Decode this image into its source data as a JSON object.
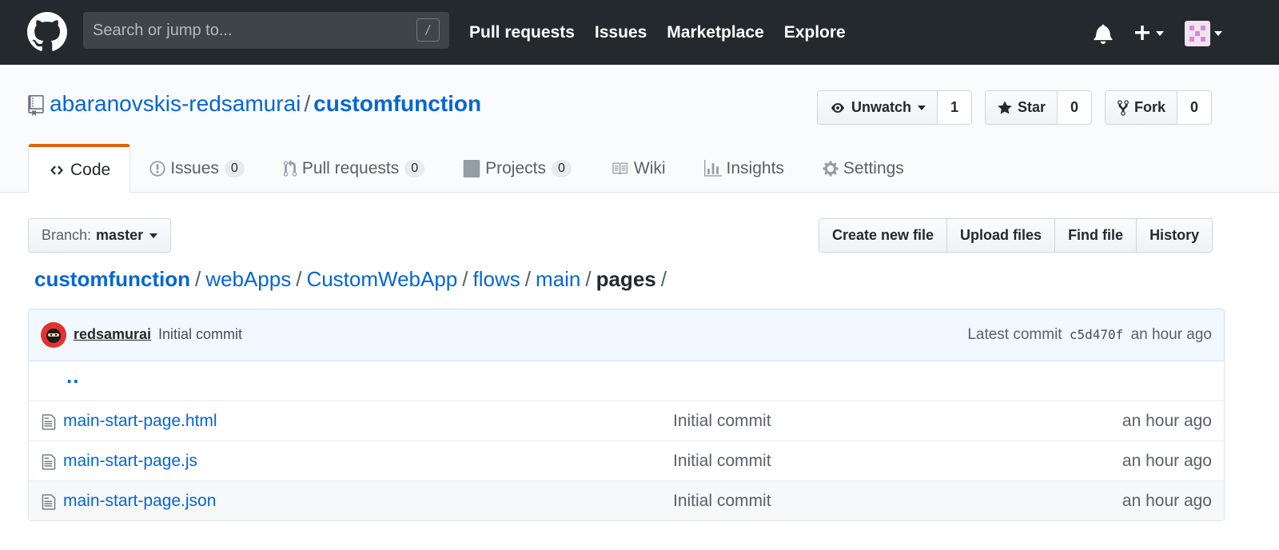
{
  "header": {
    "search_placeholder": "Search or jump to...",
    "search_shortcut": "/",
    "nav": [
      "Pull requests",
      "Issues",
      "Marketplace",
      "Explore"
    ]
  },
  "repo": {
    "owner": "abaranovskis-redsamurai",
    "separator": "/",
    "name": "customfunction"
  },
  "actions": {
    "watch_label": "Unwatch",
    "watch_count": "1",
    "star_label": "Star",
    "star_count": "0",
    "fork_label": "Fork",
    "fork_count": "0"
  },
  "tabs": [
    {
      "label": "Code",
      "counter": null
    },
    {
      "label": "Issues",
      "counter": "0"
    },
    {
      "label": "Pull requests",
      "counter": "0"
    },
    {
      "label": "Projects",
      "counter": "0"
    },
    {
      "label": "Wiki",
      "counter": null
    },
    {
      "label": "Insights",
      "counter": null
    },
    {
      "label": "Settings",
      "counter": null
    }
  ],
  "branch": {
    "label": "Branch:",
    "name": "master"
  },
  "file_actions": [
    "Create new file",
    "Upload files",
    "Find file",
    "History"
  ],
  "breadcrumb": {
    "root": "customfunction",
    "parts": [
      "webApps",
      "CustomWebApp",
      "flows",
      "main"
    ],
    "final": "pages",
    "sep": "/"
  },
  "commit": {
    "author": "redsamurai",
    "message": "Initial commit",
    "latest_label": "Latest commit",
    "sha": "c5d470f",
    "age": "an hour ago"
  },
  "files": {
    "up": "..",
    "rows": [
      {
        "name": "main-start-page.html",
        "message": "Initial commit",
        "age": "an hour ago"
      },
      {
        "name": "main-start-page.js",
        "message": "Initial commit",
        "age": "an hour ago"
      },
      {
        "name": "main-start-page.json",
        "message": "Initial commit",
        "age": "an hour ago"
      }
    ]
  },
  "colors": {
    "header_bg": "#24292e",
    "link": "#0366d6",
    "tab_accent": "#e36209",
    "commit_bg": "#f1f8ff"
  }
}
